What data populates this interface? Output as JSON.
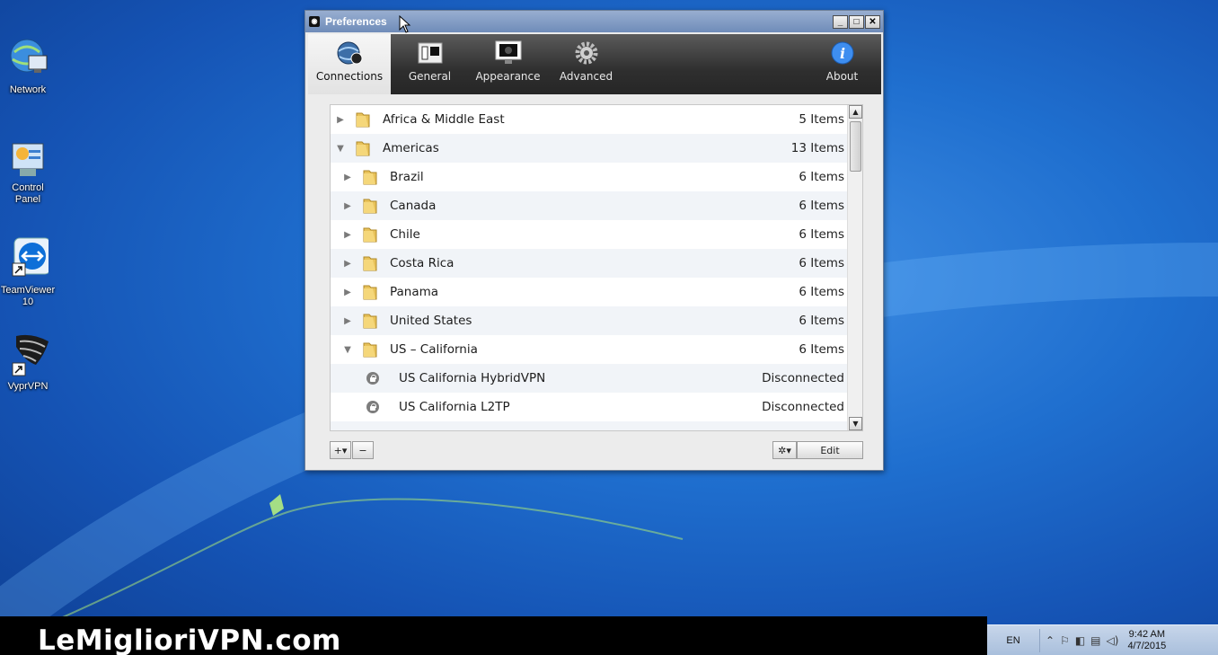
{
  "desktop": {
    "icons": [
      {
        "label": "Network",
        "icon": "network-icon"
      },
      {
        "label": "Control Panel",
        "icon": "control-panel-icon"
      },
      {
        "label": "TeamViewer\n10",
        "icon": "teamviewer-icon"
      },
      {
        "label": "VyprVPN",
        "icon": "vyprvpn-icon"
      }
    ]
  },
  "window": {
    "title": "Preferences",
    "controls": {
      "minimize": "_",
      "maximize": "□",
      "close": "✕"
    },
    "toolbar": {
      "tabs": [
        {
          "label": "Connections",
          "icon": "globe-connections-icon",
          "active": true
        },
        {
          "label": "General",
          "icon": "general-switch-icon",
          "active": false
        },
        {
          "label": "Appearance",
          "icon": "monitor-appearance-icon",
          "active": false
        },
        {
          "label": "Advanced",
          "icon": "gear-icon",
          "active": false
        }
      ],
      "about": {
        "label": "About",
        "icon": "info-icon"
      }
    },
    "list": {
      "rows": [
        {
          "arrow": "▶",
          "name": "Africa & Middle East",
          "value": "5 Items",
          "type": "folder",
          "level": 0
        },
        {
          "arrow": "▼",
          "name": "Americas",
          "value": "13 Items",
          "type": "folder",
          "level": 0
        },
        {
          "arrow": "▶",
          "name": "Brazil",
          "value": "6 Items",
          "type": "folder",
          "level": 1
        },
        {
          "arrow": "▶",
          "name": "Canada",
          "value": "6 Items",
          "type": "folder",
          "level": 1
        },
        {
          "arrow": "▶",
          "name": "Chile",
          "value": "6 Items",
          "type": "folder",
          "level": 1
        },
        {
          "arrow": "▶",
          "name": "Costa Rica",
          "value": "6 Items",
          "type": "folder",
          "level": 1
        },
        {
          "arrow": "▶",
          "name": "Panama",
          "value": "6 Items",
          "type": "folder",
          "level": 1
        },
        {
          "arrow": "▶",
          "name": "United States",
          "value": "6 Items",
          "type": "folder",
          "level": 1
        },
        {
          "arrow": "▼",
          "name": "US – California",
          "value": "6 Items",
          "type": "folder",
          "level": 1
        },
        {
          "arrow": "",
          "name": "US California HybridVPN",
          "value": "Disconnected",
          "type": "server",
          "level": 2
        },
        {
          "arrow": "",
          "name": "US California L2TP",
          "value": "Disconnected",
          "type": "server",
          "level": 2
        }
      ]
    },
    "bottom": {
      "add_label": "+▾",
      "remove_label": "−",
      "gear_label": "✲▾",
      "edit_label": "Edit"
    }
  },
  "banner": {
    "text": "LeMiglioriVPN.com"
  },
  "taskbar": {
    "language": "EN",
    "time": "9:42 AM",
    "date": "4/7/2015"
  },
  "colors": {
    "desktop_blue": "#1f6fcf",
    "toolbar_dark": "#2f2f2f",
    "row_alt": "#f1f4f8"
  }
}
